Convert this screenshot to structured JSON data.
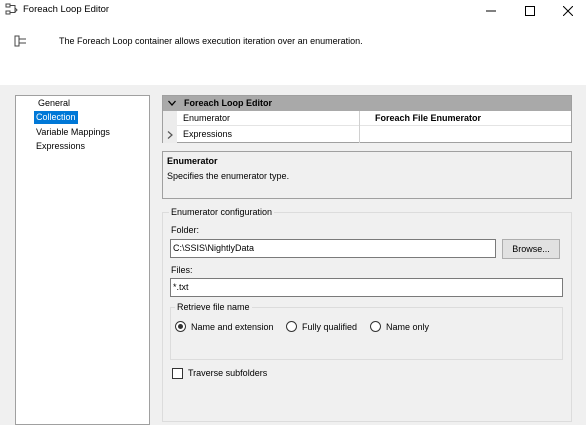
{
  "window": {
    "title": "Foreach Loop Editor"
  },
  "header": {
    "description": "The Foreach Loop container allows execution iteration over an enumeration."
  },
  "nav": {
    "items": [
      "General",
      "Collection",
      "Variable Mappings",
      "Expressions"
    ],
    "selected": "Collection"
  },
  "grid": {
    "category": "Foreach Loop Editor",
    "rows": [
      {
        "name": "Enumerator",
        "value": "Foreach File Enumerator"
      },
      {
        "name": "Expressions",
        "value": ""
      }
    ]
  },
  "description": {
    "title": "Enumerator",
    "text": "Specifies the enumerator type."
  },
  "config": {
    "legend": "Enumerator configuration",
    "folder_label": "Folder:",
    "folder_value": "C:\\SSIS\\NightlyData",
    "browse_label": "Browse...",
    "files_label": "Files:",
    "files_value": "*.txt",
    "retrieve_legend": "Retrieve file name",
    "options": [
      "Name and extension",
      "Fully qualified",
      "Name only"
    ],
    "selected_option": "Name and extension",
    "traverse_label": "Traverse subfolders",
    "traverse_checked": false
  },
  "colors": {
    "selection": "#0078d7",
    "category_band": "#a9a9a9",
    "background": "#f0f0f0"
  }
}
